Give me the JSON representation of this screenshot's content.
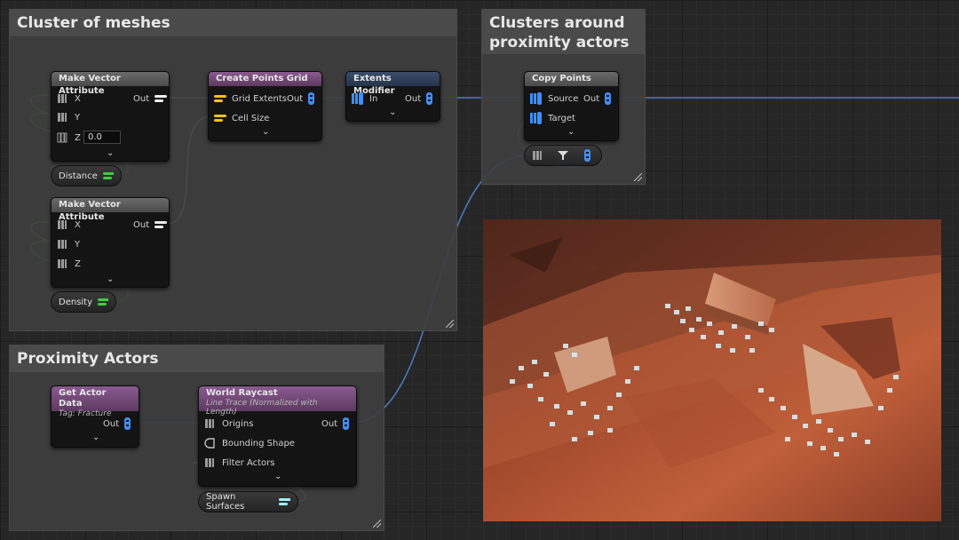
{
  "comments": {
    "cluster": "Cluster of meshes",
    "clusters_around": "Clusters around proximity actors",
    "proximity": "Proximity Actors"
  },
  "nodes": {
    "make_vector_1": {
      "title": "Make Vector Attribute",
      "x": "X",
      "y": "Y",
      "z": "Z",
      "z_value": "0.0",
      "out": "Out"
    },
    "distance": "Distance",
    "make_vector_2": {
      "title": "Make Vector Attribute",
      "x": "X",
      "y": "Y",
      "z": "Z",
      "out": "Out"
    },
    "density": "Density",
    "create_points_grid": {
      "title": "Create Points Grid",
      "grid_extents": "Grid Extents",
      "cell_size": "Cell Size",
      "out": "Out"
    },
    "extents_modifier": {
      "title": "Extents Modifier",
      "in": "In",
      "out": "Out"
    },
    "copy_points": {
      "title": "Copy Points",
      "source": "Source",
      "target": "Target",
      "out": "Out"
    },
    "get_actor_data": {
      "title": "Get Actor Data",
      "subtitle": "Tag: Fracture",
      "out": "Out"
    },
    "world_raycast": {
      "title": "World Raycast",
      "subtitle": "Line Trace (Normalized with Length)",
      "origins": "Origins",
      "bounding_shape": "Bounding Shape",
      "filter_actors": "Filter Actors",
      "out": "Out"
    },
    "spawn_surfaces": "Spawn Surfaces"
  },
  "colors": {
    "pin_blue": "#3f8fff",
    "pin_yellow": "#f2c21a",
    "pin_green": "#3ccf3c",
    "pin_white": "#eeeeee",
    "pin_cyan": "#9ef2f2",
    "wire_blue": "#4d7cc0",
    "wire_white": "#d6d6d6",
    "wire_green": "#4cc24c"
  },
  "icons": [
    "attribute-pin-icon",
    "point-pin-icon",
    "float-pin-icon",
    "filter-icon",
    "spatial-pin-icon",
    "chevron-down-icon"
  ]
}
